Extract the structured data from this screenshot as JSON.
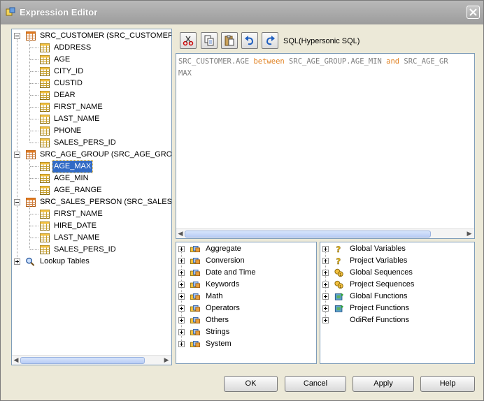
{
  "window": {
    "title": "Expression Editor"
  },
  "tree": {
    "groups": [
      {
        "label": "SRC_CUSTOMER (SRC_CUSTOMER)",
        "expanded": true,
        "items": [
          "ADDRESS",
          "AGE",
          "CITY_ID",
          "CUSTID",
          "DEAR",
          "FIRST_NAME",
          "LAST_NAME",
          "PHONE",
          "SALES_PERS_ID"
        ]
      },
      {
        "label": "SRC_AGE_GROUP (SRC_AGE_GROUP)",
        "expanded": true,
        "items": [
          "AGE_MAX",
          "AGE_MIN",
          "AGE_RANGE"
        ],
        "selected": "AGE_MAX"
      },
      {
        "label": "SRC_SALES_PERSON (SRC_SALES_PER",
        "expanded": true,
        "items": [
          "FIRST_NAME",
          "HIRE_DATE",
          "LAST_NAME",
          "SALES_PERS_ID"
        ]
      },
      {
        "label": "Lookup Tables",
        "expanded": false,
        "items": []
      }
    ]
  },
  "toolbar": {
    "buttons": [
      "cut",
      "copy",
      "paste",
      "undo",
      "redo"
    ],
    "dialect_label": "SQL(Hypersonic SQL)"
  },
  "editor": {
    "line1": [
      "SRC_CUSTOMER.AGE ",
      "between",
      " SRC_AGE_GROUP.AGE_MIN ",
      "and",
      " SRC_AGE_GR"
    ],
    "line2": "MAX"
  },
  "functions": [
    "Aggregate",
    "Conversion",
    "Date and Time",
    "Keywords",
    "Math",
    "Operators",
    "Others",
    "Strings",
    "System"
  ],
  "variables": [
    "Global Variables",
    "Project Variables",
    "Global Sequences",
    "Project Sequences",
    "Global Functions",
    "Project Functions",
    "OdiRef Functions"
  ],
  "buttons": {
    "ok": "OK",
    "cancel": "Cancel",
    "apply": "Apply",
    "help": "Help"
  },
  "colors": {
    "selection": "#316ac5",
    "keyword": "#e08020",
    "code_text": "#808080",
    "panel_border": "#7f9db9"
  }
}
